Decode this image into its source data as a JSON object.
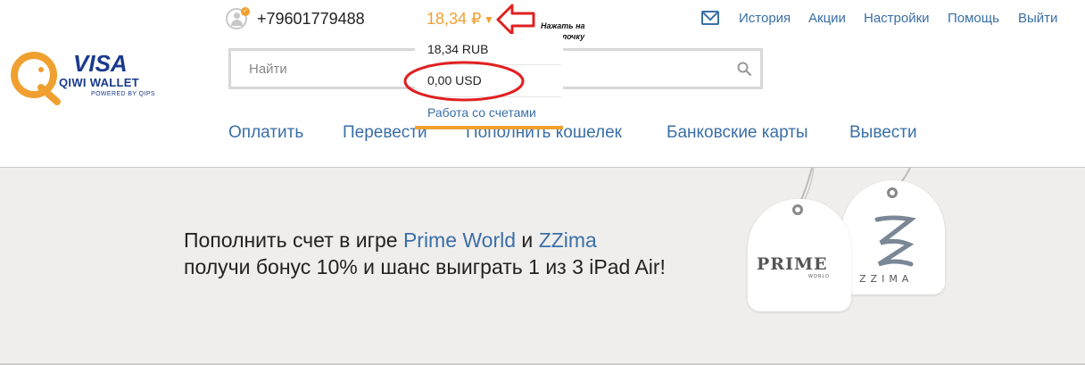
{
  "logo": {
    "brand": "VISA",
    "product": "QIWI WALLET",
    "tagline": "POWERED BY QIPS"
  },
  "account": {
    "phone": "+79601779488",
    "balance": "18,34 ₽"
  },
  "annotation": {
    "hint": "Нажать на стрелочку"
  },
  "top_links": [
    "История",
    "Акции",
    "Настройки",
    "Помощь",
    "Выйти"
  ],
  "search": {
    "placeholder": "Найти"
  },
  "balance_dropdown": {
    "items": [
      "18,34 RUB",
      "0,00 USD"
    ],
    "link": "Работа со счетами"
  },
  "main_nav": [
    "Оплатить",
    "Перевести",
    "Пополнить кошелек",
    "Банковские карты",
    "Вывести"
  ],
  "banner": {
    "line1_prefix": "Пополнить счет в игре ",
    "game1": "Prime World",
    "line1_mid": " и ",
    "game2": "ZZima",
    "line2": "получи бонус 10% и шанс выиграть 1 из 3 iPad Air!",
    "tag1_text": "PRIME",
    "tag1_sub": "WORLD",
    "tag2_text": "ZZIMA"
  },
  "colors": {
    "accent_blue": "#3a6fa8",
    "brand_orange": "#f0a030",
    "annotation_red": "#e02020",
    "banner_bg": "#f0eeec"
  }
}
